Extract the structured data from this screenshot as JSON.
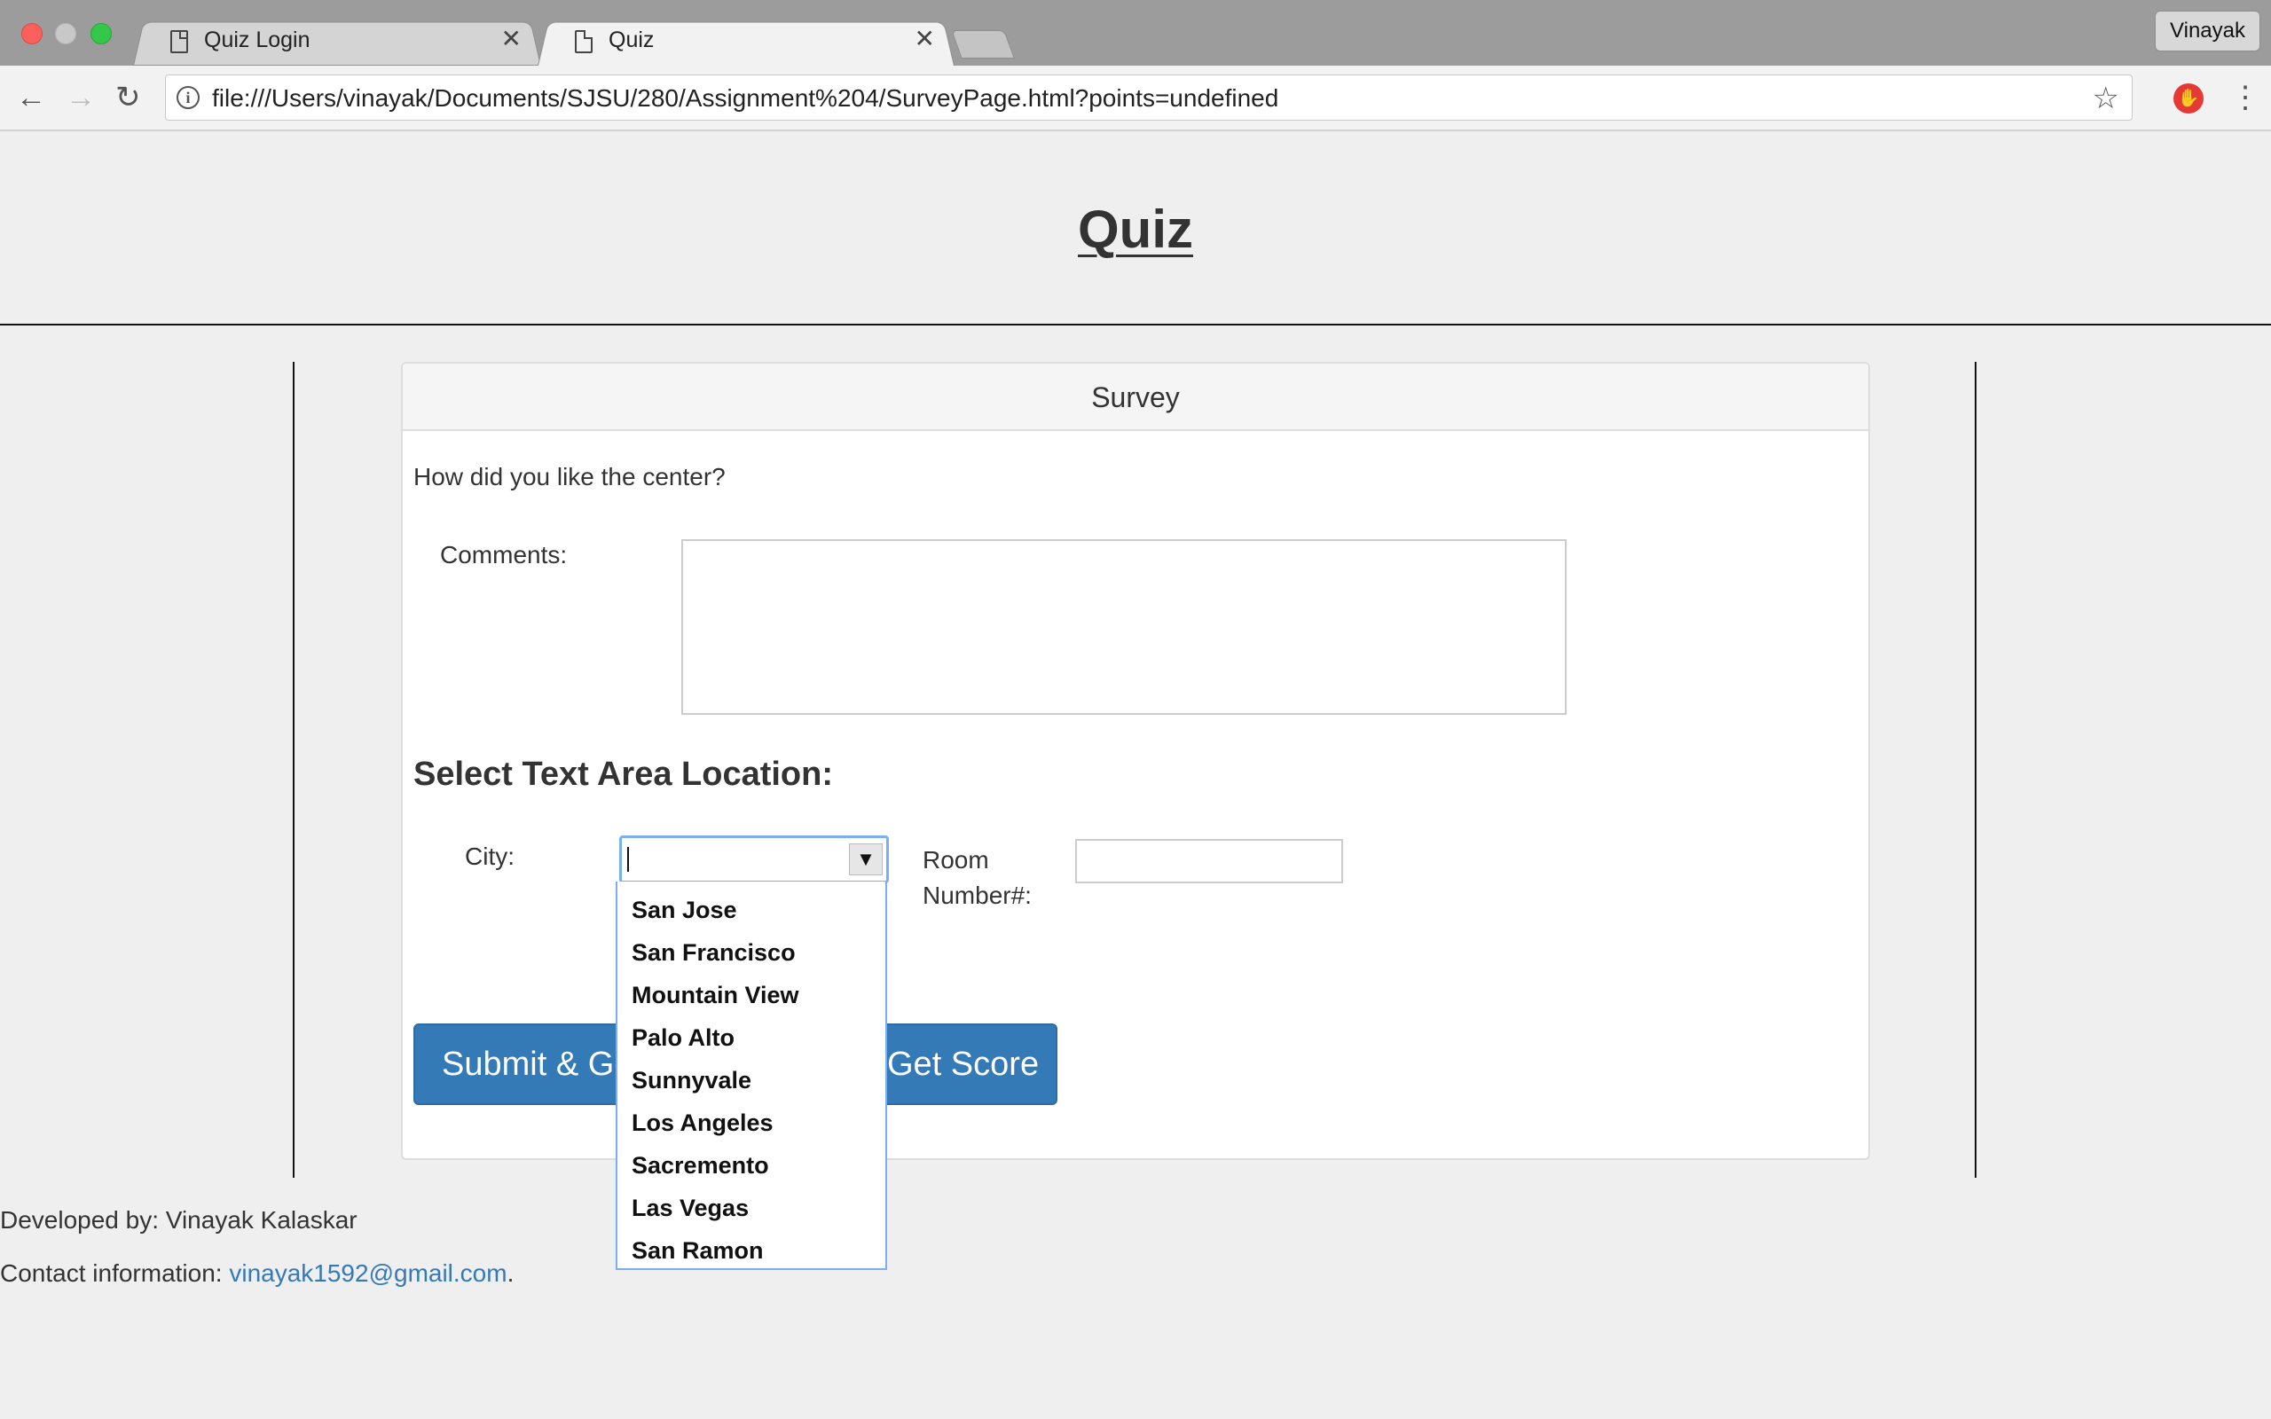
{
  "browser": {
    "tabs": [
      {
        "title": "Quiz Login",
        "active": false
      },
      {
        "title": "Quiz",
        "active": true
      }
    ],
    "profile_name": "Vinayak",
    "url": "file:///Users/vinayak/Documents/SJSU/280/Assignment%204/SurveyPage.html?points=undefined",
    "icons": {
      "back": "back-arrow-icon",
      "forward": "forward-arrow-icon",
      "reload": "reload-icon",
      "info": "info-icon",
      "bookmark": "star-icon",
      "extension": "adblock-icon",
      "menu": "kebab-menu-icon"
    }
  },
  "page": {
    "title": "Quiz",
    "panel": {
      "heading": "Survey",
      "question": "How did you like the center?",
      "comments_label": "Comments:",
      "comments_value": "",
      "location_heading": "Select Text Area Location:",
      "city_label": "City:",
      "city_value": "",
      "room_label": "Room Number#:",
      "room_value": "",
      "submit_button": "Submit & Get",
      "score_button": "Get Score"
    },
    "city_options": [
      "San Jose",
      "San Francisco",
      "Mountain View",
      "Palo Alto",
      "Sunnyvale",
      "Los Angeles",
      "Sacremento",
      "Las Vegas",
      "San Ramon"
    ],
    "footer": {
      "developed_by": "Developed by: Vinayak Kalaskar",
      "contact_prefix": "Contact information: ",
      "contact_email": "vinayak1592@gmail.com",
      "contact_suffix": "."
    }
  },
  "colors": {
    "primary_button": "#337ab7",
    "focus_border": "#7bb0f0",
    "link": "#337ab7",
    "page_background": "#efefef"
  }
}
